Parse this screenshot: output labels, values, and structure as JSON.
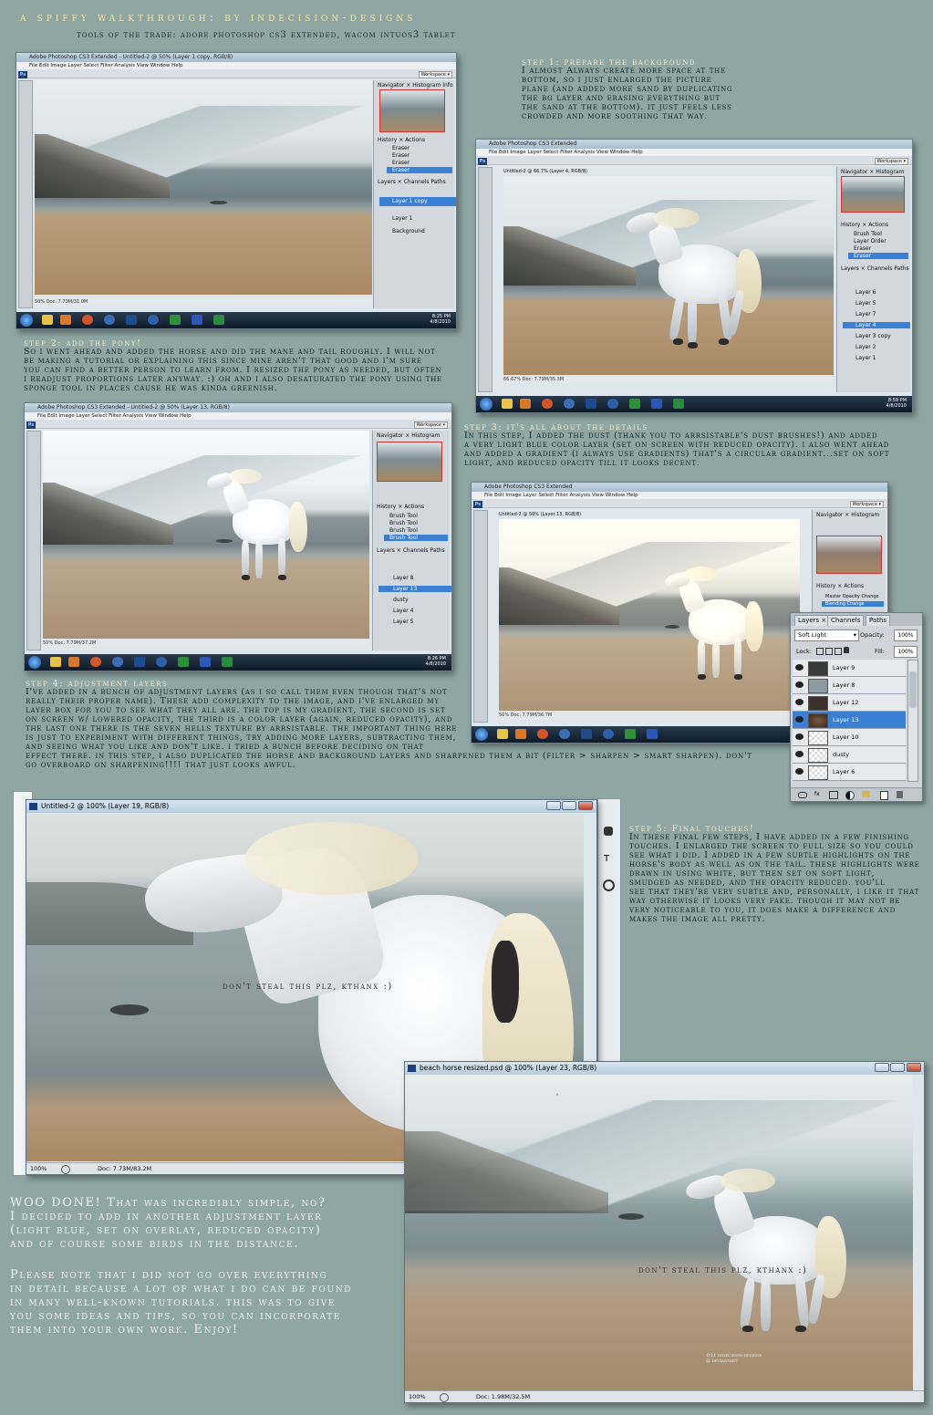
{
  "header": {
    "title": "a spiffy walkthrough: by indecision-designs",
    "subtitle": "tools of the trade: adobe photoshop cs3 extended, wacom intuos3 tablet"
  },
  "steps": [
    {
      "heading": "step 1: prepare the background",
      "body": "I almost Always create more space at the\nbottom, so i just enlarged the picture\nplane (and added more sand by duplicating\nthe bg layer and erasing everything but\nthe sand at the bottom). it just feels less\ncrowded and more soothing that way."
    },
    {
      "heading": "step 2: add the pony!",
      "body": "So i went ahead and added the horse and did the mane and tail roughly. I will not\nbe making a tutorial or explaining this since mine aren't that good and i'm sure\nyou can find a better person to learn from. I resized the pony as needed, but often\ni readjust proportions later anyway. :) oh and i also desaturated the pony using the\nsponge tool in places cause he was kinda greenish."
    },
    {
      "heading": "step 3: it's all about the details",
      "body": "In this step, I added the dust (thank you to arrsistable's dust brushes!) and added\na very light blue color layer (set on screen with reduced opacity). i also went ahead\nand added a gradient (i always use gradients) that's a circular gradient...set on soft\nlight, and reduced opacity till it looks decent."
    },
    {
      "heading": "step 4: adjustment layers",
      "body": "I've added in a bunch of adjustment layers (as i so call them even though that's not\nreally their proper name). These add complexity to the image, and i've enlarged my\nlayer box for you to see what they all are. the top is my gradient, the second is set\non screen w/ lowered opacity, the third is a color layer (again, reduced opacity), and\nthe last one there is the seven hells texture by arrsistable. the important thing here\nis just to experiment with different things, try adding more layers, subtracting them,\nand seeing what you like and don't like. i tried a bunch before deciding on that\neffect there. in this step, i also duplicated the horse and background layers and sharpened them a bit (filter > sharpen > smart sharpen). don't\ngo overboard on sharpening!!!! that just looks awful."
    },
    {
      "heading": "step 5: Final touches!",
      "body": "In these final few steps, I have added in a few finishing\ntouches. I enlarged the screen to full size so you could\nsee what i did. I added in a few subtle highlights on the\nhorse's body as well as on the tail. these highlights were\ndrawn in using white, but then set on soft light,\nsmudged as needed, and the opacity reduced. you'll\nsee that they're very subtle and, personally, i like it that\nway otherwise it looks very fake. though it may not be\nvery noticeable to you, it does make a difference and\nmakes the image all pretty."
    }
  ],
  "closing": {
    "text1": "WOO DONE! That was incredibly simple, no?\nI decided to add in another adjustment layer\n(light blue, set on overlay, reduced opacity)\nand of course some birds in the distance.",
    "text2": "Please note that i did not go over everything\nin detail because a lot of what i do can be found\nin many well-known tutorials. this was to give\nyou some ideas and tips, so you can incorporate\nthem into your own work. Enjoy!"
  },
  "watermark": "don't steal this plz, kthanx :)",
  "windows": {
    "w1": {
      "title": "Adobe Photoshop CS3 Extended - Untitled-2 @ 50% (Layer 1 copy, RGB/8)",
      "menu": "File  Edit  Image  Layer  Select  Filter  Analysis  View  Window  Help",
      "status": "50%      Doc: 7.79M/31.0M",
      "clock": "8:25 PM\n4/8/2010",
      "workspace": "Workspace ▾",
      "history": [
        "Eraser",
        "Eraser",
        "Eraser",
        "Eraser"
      ],
      "layers": [
        "Layer 1 copy",
        "Layer 1",
        "Background"
      ]
    },
    "w2": {
      "title": "Adobe Photoshop CS3 Extended",
      "doc": "Untitled-2 @ 66.7% (Layer 4, RGB/8)",
      "menu": "File  Edit  Image  Layer  Select  Filter  Analysis  View  Window  Help",
      "status": "66.67%    Doc: 7.79M/35.3M",
      "clock": "8:59 PM\n4/8/2010",
      "workspace": "Workspace ▾",
      "history": [
        "Brush Tool",
        "Layer Order",
        "Eraser",
        "Eraser"
      ],
      "layers": [
        "Layer 6",
        "Layer 5",
        "Layer 7",
        "Layer 4",
        "Layer 3 copy",
        "Layer 2",
        "Layer 1"
      ]
    },
    "w3": {
      "title": "Adobe Photoshop CS3 Extended - Untitled-2 @ 50% (Layer 13, RGB/8)",
      "menu": "File  Edit  Image  Layer  Select  Filter  Analysis  View  Window  Help",
      "status": "50%      Doc: 7.79M/37.2M",
      "clock": "8:26 PM\n4/8/2010",
      "workspace": "Workspace ▾",
      "history": [
        "Brush Tool",
        "Brush Tool",
        "Brush Tool",
        "Brush Tool"
      ],
      "layers": [
        "Layer 8",
        "Layer 13",
        "dusty",
        "Layer 4",
        "Layer 5"
      ]
    },
    "w4": {
      "title": "Adobe Photoshop CS3 Extended",
      "doc": "Untitled-2 @ 50% (Layer 13, RGB/8)",
      "menu": "File  Edit  Image  Layer  Select  Filter  Analysis  View  Window  Help",
      "status": "50%      Doc: 7.79M/36.7M",
      "workspace": "Workspace ▾",
      "history": [
        "Master Opacity Change",
        "Blending Change"
      ]
    },
    "w5": {
      "title": "Untitled-2 @ 100% (Layer 19, RGB/8)",
      "status_zoom": "100%",
      "status_doc": "Doc: 7.73M/83.2M"
    },
    "w6": {
      "title": "beach horse resized.psd @ 100% (Layer 23, RGB/8)",
      "status_zoom": "100%",
      "status_doc": "Doc: 1.98M/32.5M",
      "signature": "©11 indecision-designs\n@ deviantart"
    }
  },
  "layers_panel": {
    "tabs": [
      "Layers ×",
      "Channels",
      "Paths"
    ],
    "blend_mode": "Soft Light",
    "opacity_label": "Opacity:",
    "opacity_value": "100%",
    "lock_label": "Lock:",
    "fill_label": "Fill:",
    "fill_value": "100%",
    "layers": [
      {
        "name": "Layer 9",
        "thumb": "#3a3a3a"
      },
      {
        "name": "Layer 8",
        "thumb": "#8b9aa0"
      },
      {
        "name": "Layer 12",
        "thumb": "#3b302c"
      },
      {
        "name": "Layer 13",
        "thumb": "#6e4a36",
        "selected": true
      },
      {
        "name": "Layer 10",
        "thumb": "#efefef"
      },
      {
        "name": "dusty",
        "thumb": "#e9e9e9"
      },
      {
        "name": "Layer 6",
        "thumb": "#e9e9e9"
      }
    ]
  },
  "colors": {
    "background": "#8fa6a3",
    "title": "#f3e6a6",
    "step_heading": "#f1ecd0",
    "selected": "#3a7fd4"
  }
}
